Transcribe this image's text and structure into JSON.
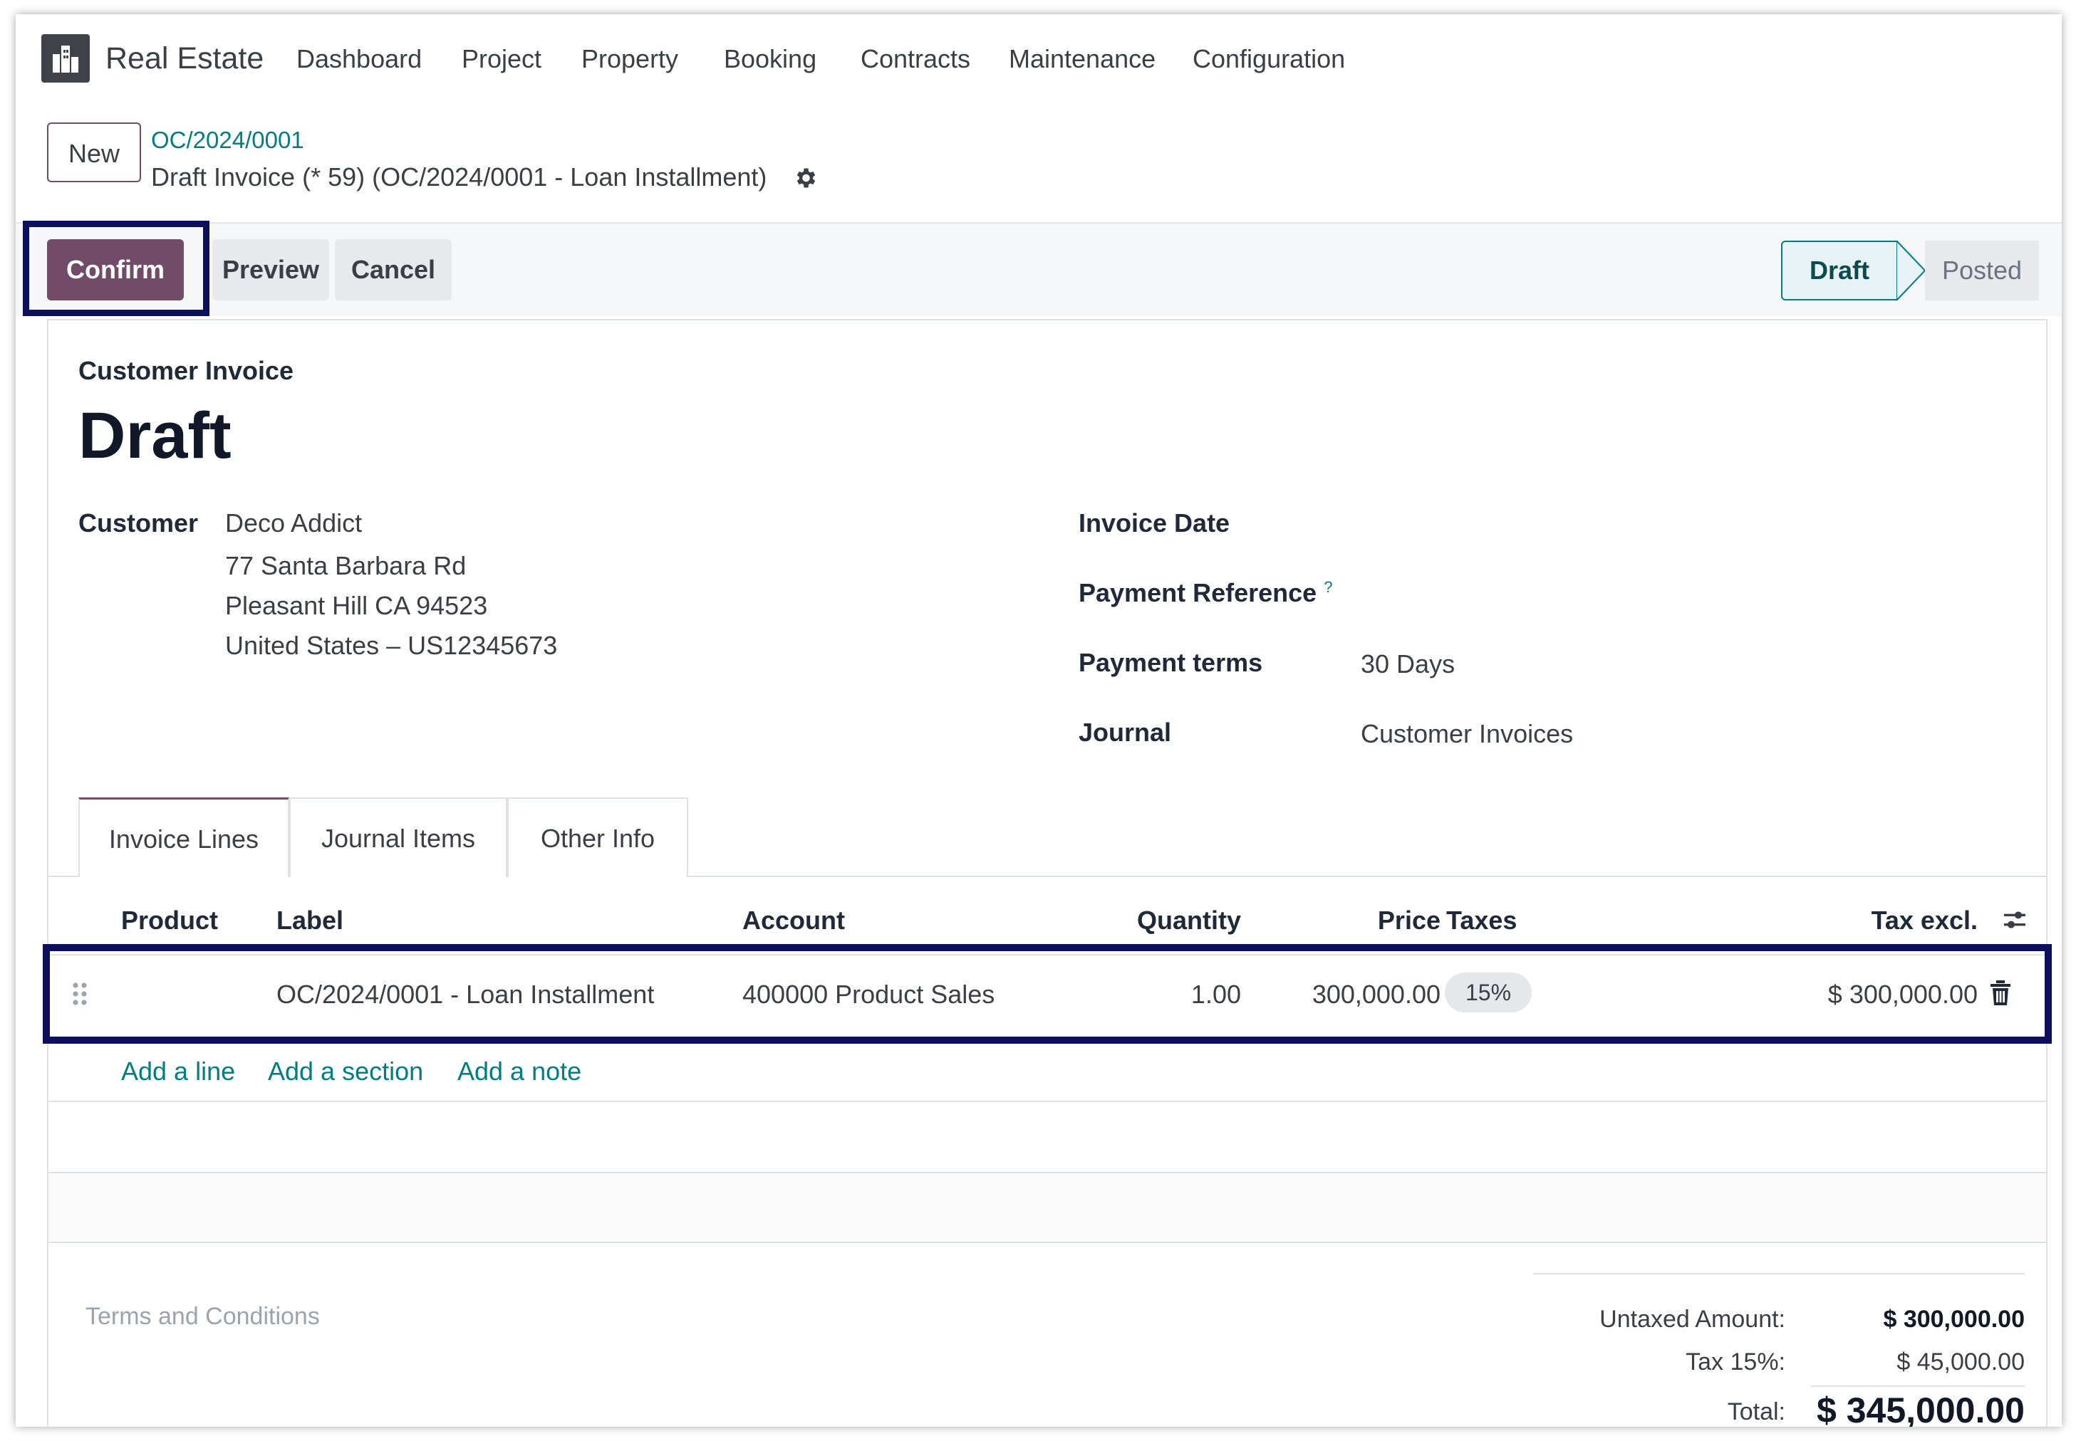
{
  "navbar": {
    "app_name": "Real Estate",
    "menu": [
      "Dashboard",
      "Project",
      "Property",
      "Booking",
      "Contracts",
      "Maintenance",
      "Configuration"
    ]
  },
  "control_panel": {
    "new_label": "New",
    "breadcrumb": "OC/2024/0001",
    "record_title": "Draft Invoice (* 59) (OC/2024/0001 - Loan Installment)"
  },
  "actions": {
    "confirm": "Confirm",
    "preview": "Preview",
    "cancel": "Cancel"
  },
  "statusbar": {
    "stages": [
      "Draft",
      "Posted"
    ],
    "current": "Draft"
  },
  "form": {
    "type_label": "Customer Invoice",
    "title": "Draft",
    "customer_label": "Customer",
    "customer": {
      "name": "Deco Addict",
      "address_lines": [
        "77 Santa Barbara Rd",
        "Pleasant Hill CA 94523",
        "United States – US12345673"
      ]
    },
    "invoice_date_label": "Invoice Date",
    "invoice_date": "",
    "payment_reference_label": "Payment Reference",
    "payment_reference_help": "?",
    "payment_terms_label": "Payment terms",
    "payment_terms": "30 Days",
    "journal_label": "Journal",
    "journal": "Customer Invoices"
  },
  "tabs": [
    "Invoice Lines",
    "Journal Items",
    "Other Info"
  ],
  "lines_table": {
    "headers": {
      "product": "Product",
      "label": "Label",
      "account": "Account",
      "quantity": "Quantity",
      "price": "Price",
      "taxes": "Taxes",
      "tax_excl": "Tax excl."
    },
    "rows": [
      {
        "product": "",
        "label": "OC/2024/0001 - Loan Installment",
        "account": "400000 Product Sales",
        "quantity": "1.00",
        "price": "300,000.00",
        "taxes": "15%",
        "tax_excl": "$ 300,000.00"
      }
    ],
    "add_links": [
      "Add a line",
      "Add a section",
      "Add a note"
    ]
  },
  "footer": {
    "terms_placeholder": "Terms and Conditions",
    "untaxed_label": "Untaxed Amount:",
    "untaxed_value": "$ 300,000.00",
    "tax_label": "Tax 15%:",
    "tax_value": "$ 45,000.00",
    "total_label": "Total:",
    "total_value": "$ 345,000.00"
  },
  "colors": {
    "primary": "#714b67",
    "link": "#017e84",
    "highlight_box": "#0b0f5c"
  }
}
